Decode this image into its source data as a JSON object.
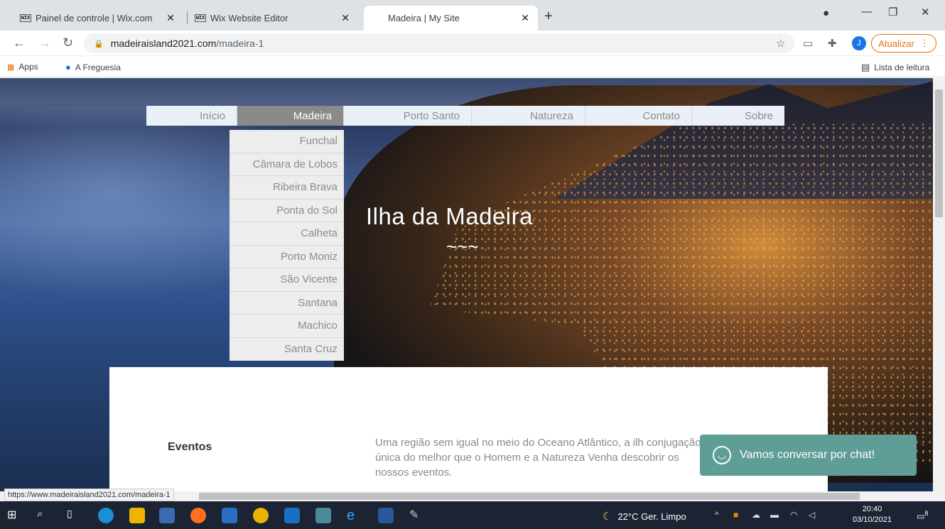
{
  "browser": {
    "tabs": [
      {
        "favicon": "WIX",
        "title": "Painel de controle | Wix.com"
      },
      {
        "favicon": "WIX",
        "title": "Wix Website Editor"
      },
      {
        "favicon": "",
        "title": "Madeira | My Site"
      }
    ],
    "url_domain": "madeiraisland2021.com",
    "url_path": "/madeira-1",
    "avatar_initial": "J",
    "update_label": "Atualizar",
    "bookmarks": {
      "apps": "Apps",
      "freguesia": "A Freguesia",
      "reading_list": "Lista de leitura"
    },
    "status_url": "https://www.madeiraisland2021.com/madeira-1"
  },
  "site": {
    "nav": [
      "Início",
      "Madeira",
      "Porto Santo",
      "Natureza",
      "Contato",
      "Sobre"
    ],
    "active_nav": "Madeira",
    "dropdown": [
      "Funchal",
      "Câmara de Lobos",
      "Ribeira Brava",
      "Ponta do Sol",
      "Calheta",
      "Porto Moniz",
      "São Vicente",
      "Santana",
      "Machico",
      "Santa Cruz"
    ],
    "hero_title": "Ilha da Madeira",
    "hero_ornament": "~~~",
    "section_title": "Eventos",
    "paragraph": "Uma região sem igual no meio do Oceano Atlântico, a ilh conjugação única do melhor que o Homem e a Natureza Venha descobrir os nossos eventos.",
    "chat_label": "Vamos conversar por chat!"
  },
  "taskbar": {
    "weather": "22°C  Ger. Limpo",
    "time": "20:40",
    "date": "03/10/2021",
    "notifications": "8"
  }
}
